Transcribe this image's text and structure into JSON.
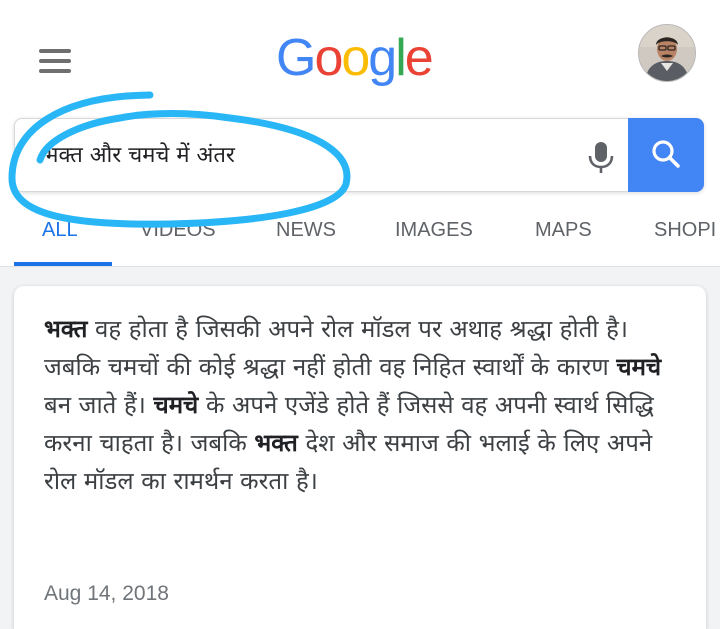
{
  "header": {
    "logo_letters": [
      "G",
      "o",
      "o",
      "g",
      "l",
      "e"
    ],
    "logo_colors": [
      "#4285f4",
      "#ea4335",
      "#fbbc05",
      "#4285f4",
      "#34a853",
      "#ea4335"
    ]
  },
  "search": {
    "query": "भक्त और चमचे में अंतर",
    "button_color": "#4285f4"
  },
  "tabs": [
    {
      "label": "ALL",
      "active": true
    },
    {
      "label": "VIDEOS",
      "active": false
    },
    {
      "label": "NEWS",
      "active": false
    },
    {
      "label": "IMAGES",
      "active": false
    },
    {
      "label": "MAPS",
      "active": false
    },
    {
      "label": "SHOPI",
      "active": false
    }
  ],
  "result": {
    "segments": [
      "भक्त",
      " वह होता है जिसकी अपने रोल मॉडल पर अथाह श्रद्धा होती है। जबकि चमचों की कोई श्रद्धा नहीं होती वह निहित स्वार्थों के कारण ",
      "चमचे",
      " बन जाते हैं। ",
      "चमचे",
      " के अपने एजेंडे होते हैं जिससे वह अपनी स्वार्थ सिद्धि करना चाहता है। जबकि ",
      "भक्त",
      " देश और समाज की भलाई के लिए अपने रोल मॉडल का रामर्थन करता है।"
    ],
    "date": "Aug 14, 2018"
  },
  "colors": {
    "accent": "#1a73e8",
    "annotation": "#29b6f6"
  },
  "icons": {
    "menu": "hamburger-menu-icon",
    "mic": "microphone-icon",
    "search": "search-icon",
    "avatar": "user-avatar"
  }
}
